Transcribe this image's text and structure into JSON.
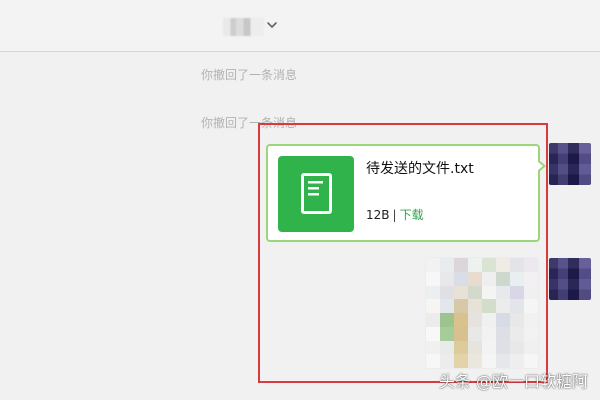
{
  "header": {
    "contact_name": "",
    "chevron_icon": "chevron-down-icon"
  },
  "messages": {
    "system_notices": [
      "你撤回了一条消息",
      "你撤回了一条消息"
    ],
    "file": {
      "filename": "待发送的文件.txt",
      "size": "12B",
      "separator": "|",
      "action": "下载",
      "icon": "document-icon"
    },
    "image": {
      "type": "blurred-map-image"
    }
  },
  "avatars": [
    {
      "name": "user-avatar"
    },
    {
      "name": "user-avatar"
    }
  ],
  "watermark": {
    "text": "头条 @欧一口软糖阿"
  },
  "colors": {
    "background": "#f1f1f1",
    "file_card_border": "#9bd67b",
    "file_icon_bg": "#2fb34a",
    "link_green": "#2fa44a",
    "highlight_red": "#d93a3f"
  }
}
